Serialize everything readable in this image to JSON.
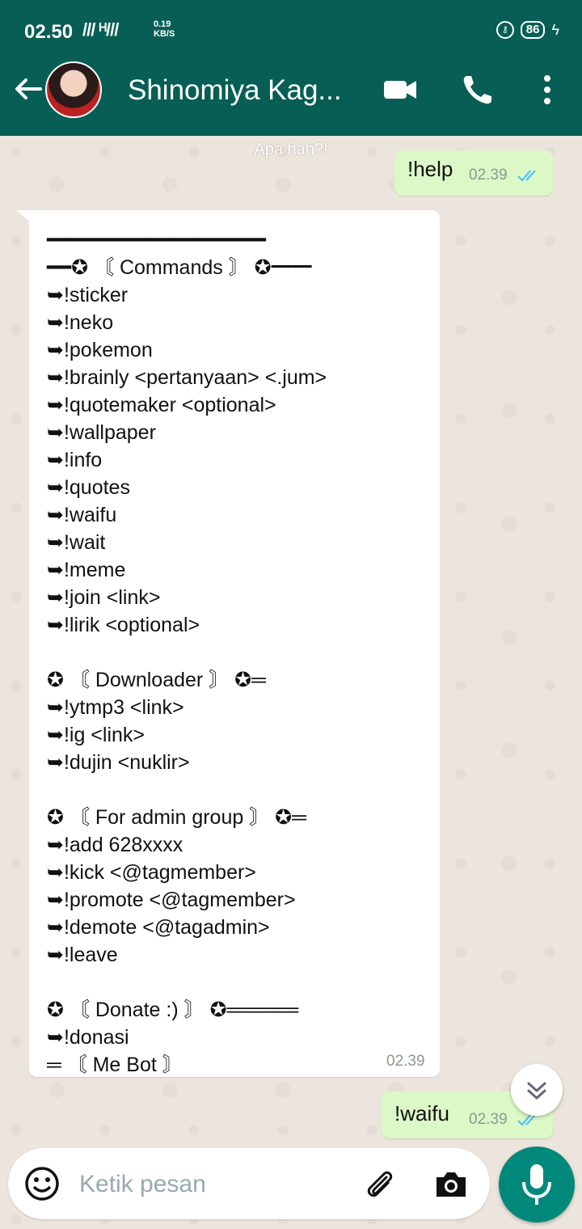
{
  "status_bar": {
    "time": "02.50",
    "signal": "/// ᴴ/// ",
    "network_speed_value": "0.19",
    "network_speed_unit": "KB/S",
    "battery": "86"
  },
  "header": {
    "contact_name": "Shinomiya Kag...",
    "icons": [
      "back-arrow-icon",
      "video-call-icon",
      "phone-icon",
      "more-vert-icon"
    ]
  },
  "date_chip": "Apa hah?!",
  "messages": [
    {
      "direction": "out",
      "text": "!help",
      "time": "02.39",
      "status": "read"
    },
    {
      "direction": "in",
      "time": "02.39",
      "lines": [
        "━━━━━━━━━━━━━━━━━━",
        "━━✪ 〘 Commands 〙 ✪━━",
        "➥!sticker",
        "➥!neko",
        "➥!pokemon",
        "➥!brainly <pertanyaan> <.jum>",
        "➥!quotemaker <optional>",
        "➥!wallpaper",
        "➥!info",
        "➥!quotes",
        "➥!waifu",
        "➥!wait",
        "➥!meme",
        "➥!join <link>",
        "➥!lirik <optional>",
        "",
        "✪ 〘 Downloader 〙 ✪═",
        "➥!ytmp3 <link>",
        "➥!ig <link>",
        "➥!dujin <nuklir>",
        "",
        "✪ 〘 For admin group 〙 ✪═",
        "➥!add 628xxxx",
        "➥!kick <@tagmember>",
        "➥!promote <@tagmember>",
        "➥!demote <@tagadmin>",
        "➥!leave",
        "",
        "✪ 〘 Donate :) 〙 ✪═════",
        "➥!donasi",
        "═ 〘 Me Bot 〙"
      ]
    },
    {
      "direction": "out",
      "text": "!waifu",
      "time": "02.39",
      "status": "read"
    }
  ],
  "composer": {
    "placeholder": "Ketik pesan",
    "icons": [
      "emoji-icon",
      "attach-icon",
      "camera-icon",
      "mic-icon"
    ]
  },
  "colors": {
    "header": "#075e54",
    "outgoing_bubble": "#dcf8c6",
    "read_ticks": "#4fc3f7",
    "mic_button": "#00897b"
  }
}
